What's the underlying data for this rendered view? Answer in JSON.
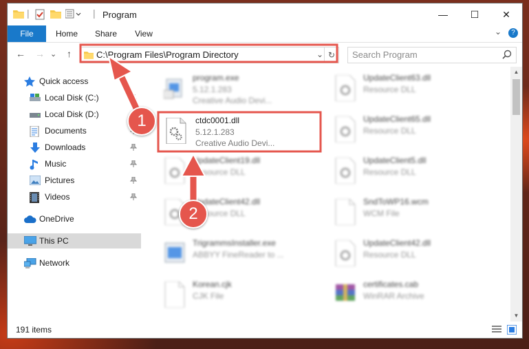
{
  "window": {
    "title": "Program",
    "minimize_glyph": "—",
    "maximize_glyph": "☐",
    "close_glyph": "✕"
  },
  "ribbon": {
    "tabs": [
      "File",
      "Home",
      "Share",
      "View"
    ],
    "expand_glyph": "⌄",
    "help_glyph": "?"
  },
  "navigation": {
    "back_glyph": "←",
    "forward_glyph": "→",
    "recent_glyph": "⌄",
    "up_glyph": "↑"
  },
  "address": {
    "path": "C:\\Program Files\\Program Directory",
    "dropdown_glyph": "⌄",
    "refresh_glyph": "↻"
  },
  "search": {
    "placeholder": "Search Program"
  },
  "nav_pane": {
    "items": [
      {
        "label": "Quick access",
        "icon": "star-icon",
        "pinned": false
      },
      {
        "label": "Local Disk (C:)",
        "icon": "drive-icon",
        "pinned": true
      },
      {
        "label": "Local Disk (D:)",
        "icon": "drive-icon",
        "pinned": true
      },
      {
        "label": "Documents",
        "icon": "documents-icon",
        "pinned": true
      },
      {
        "label": "Downloads",
        "icon": "download-icon",
        "pinned": true
      },
      {
        "label": "Music",
        "icon": "music-icon",
        "pinned": true
      },
      {
        "label": "Pictures",
        "icon": "pictures-icon",
        "pinned": true
      },
      {
        "label": "Videos",
        "icon": "videos-icon",
        "pinned": true
      },
      {
        "label": "OneDrive",
        "icon": "cloud-icon",
        "pinned": false
      },
      {
        "label": "This PC",
        "icon": "computer-icon",
        "pinned": false,
        "selected": true
      },
      {
        "label": "Network",
        "icon": "network-icon",
        "pinned": false
      }
    ]
  },
  "files": [
    {
      "name": "program.exe",
      "line2": "5.12.1.283",
      "line3": "Creative Audio Devi...",
      "icon": "exe-icon",
      "highlighted": false
    },
    {
      "name": "UpdateClient63.dll",
      "line2": "Resource DLL",
      "line3": "",
      "icon": "dll-icon",
      "highlighted": false
    },
    {
      "name": "ctdc0001.dll",
      "line2": "5.12.1.283",
      "line3": "Creative Audio Devi...",
      "icon": "dll-icon",
      "highlighted": true
    },
    {
      "name": "UpdateClient65.dll",
      "line2": "Resource DLL",
      "line3": "",
      "icon": "dll-icon",
      "highlighted": false
    },
    {
      "name": "UpdateClient19.dll",
      "line2": "Resource DLL",
      "line3": "",
      "icon": "dll-icon",
      "highlighted": false
    },
    {
      "name": "UpdateClient5.dll",
      "line2": "Resource DLL",
      "line3": "",
      "icon": "dll-icon",
      "highlighted": false
    },
    {
      "name": "UpdateClient42.dll",
      "line2": "Resource DLL",
      "line3": "",
      "icon": "dll-icon",
      "highlighted": false
    },
    {
      "name": "SndToWP16.wcm",
      "line2": "WCM File",
      "line3": "",
      "icon": "file-icon",
      "highlighted": false
    },
    {
      "name": "TrigrammsInstaller.exe",
      "line2": "ABBYY FineReader to ...",
      "line3": "",
      "icon": "installer-icon",
      "highlighted": false
    },
    {
      "name": "UpdateClient42.dll",
      "line2": "Resource DLL",
      "line3": "",
      "icon": "dll-icon",
      "highlighted": false
    },
    {
      "name": "Korean.cjk",
      "line2": "CJK File",
      "line3": "",
      "icon": "file-icon",
      "highlighted": false
    },
    {
      "name": "certificates.cab",
      "line2": "WinRAR Archive",
      "line3": "",
      "icon": "archive-icon",
      "highlighted": false
    }
  ],
  "status": {
    "item_count": "191 items"
  },
  "annotations": {
    "step1": "1",
    "step2": "2",
    "accent_color": "#e5564d"
  },
  "colors": {
    "file_tab": "#1979ca",
    "selection": "#d9d9d9",
    "highlight_box": "#e5564d"
  }
}
